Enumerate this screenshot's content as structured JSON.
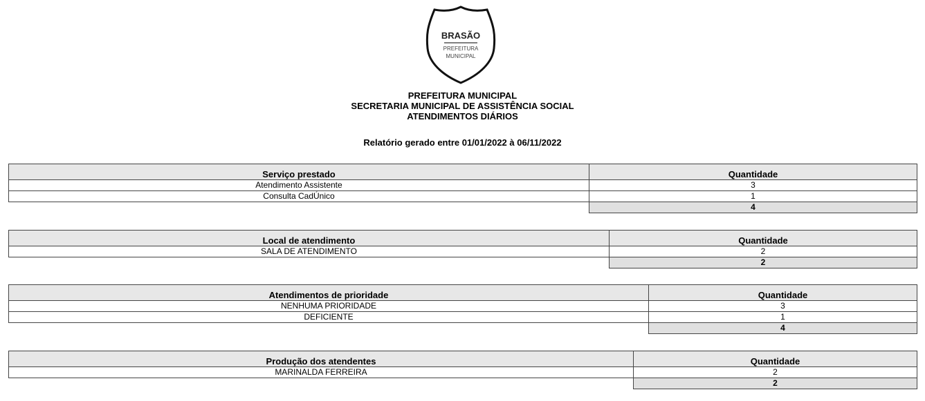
{
  "crest": {
    "title": "BRASÃO",
    "line1": "PREFEITURA",
    "line2": "MUNICIPAL"
  },
  "header": {
    "line1": "PREFEITURA MUNICIPAL",
    "line2": "SECRETARIA MUNICIPAL DE ASSISTÊNCIA SOCIAL",
    "line3": "ATENDIMENTOS DIÁRIOS"
  },
  "subtitle": "Relatório gerado entre 01/01/2022 à 06/11/2022",
  "tables": [
    {
      "col1": "Serviço prestado",
      "col2": "Quantidade",
      "rows": [
        {
          "label": "Atendimento Assistente",
          "value": "3"
        },
        {
          "label": "Consulta CadÚnico",
          "value": "1"
        }
      ],
      "total": "4"
    },
    {
      "col1": "Local de atendimento",
      "col2": "Quantidade",
      "rows": [
        {
          "label": "SALA DE ATENDIMENTO",
          "value": "2"
        }
      ],
      "total": "2"
    },
    {
      "col1": "Atendimentos de prioridade",
      "col2": "Quantidade",
      "rows": [
        {
          "label": "NENHUMA PRIORIDADE",
          "value": "3"
        },
        {
          "label": "DEFICIENTE",
          "value": "1"
        }
      ],
      "total": "4"
    },
    {
      "col1": "Produção dos atendentes",
      "col2": "Quantidade",
      "rows": [
        {
          "label": "MARINALDA FERREIRA",
          "value": "2"
        }
      ],
      "total": "2"
    }
  ]
}
